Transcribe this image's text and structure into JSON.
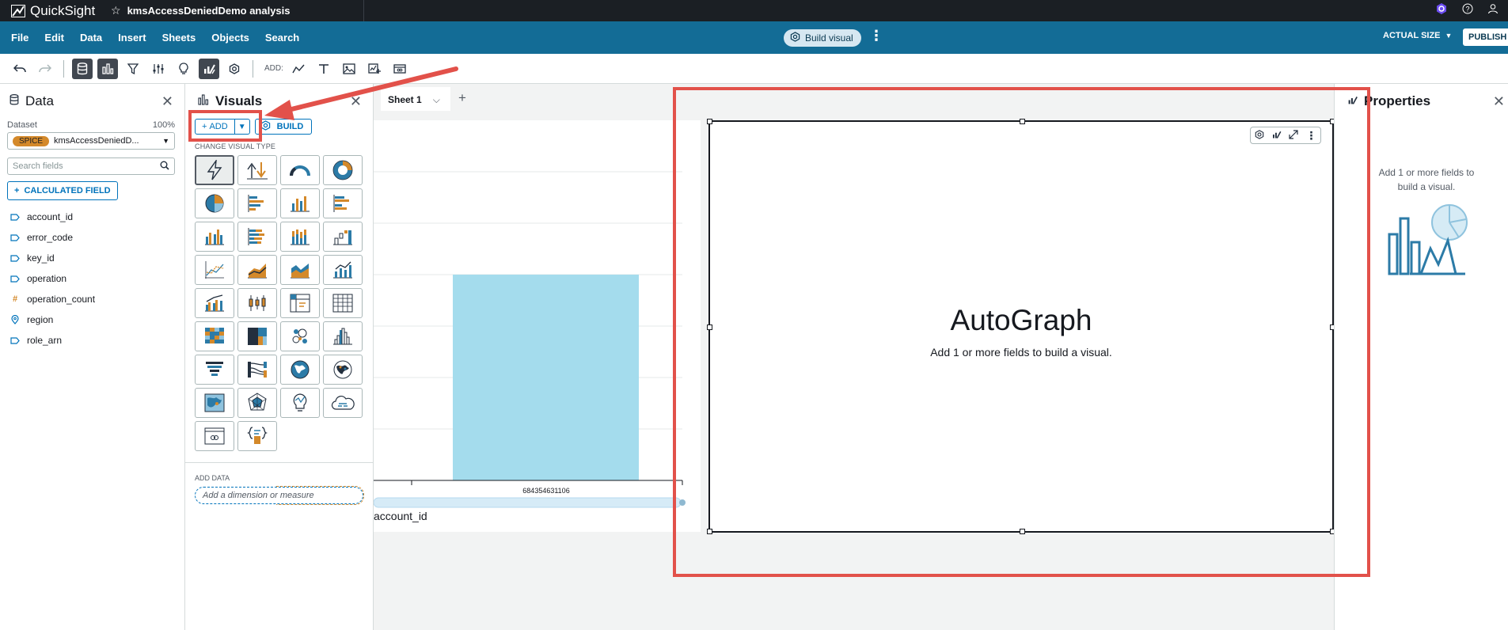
{
  "app": {
    "brand": "QuickSight",
    "analysis_title": "kmsAccessDeniedDemo analysis"
  },
  "menu": {
    "items": [
      "File",
      "Edit",
      "Data",
      "Insert",
      "Sheets",
      "Objects",
      "Search"
    ],
    "build_visual": "Build visual",
    "size_label": "ACTUAL SIZE",
    "publish": "PUBLISH"
  },
  "toolbar": {
    "add_label": "ADD:"
  },
  "data_panel": {
    "title": "Data",
    "dataset_label": "Dataset",
    "dataset_pct": "100%",
    "spice_badge": "SPICE",
    "dataset_name": "kmsAccessDeniedD...",
    "search_placeholder": "Search fields",
    "calc_field": "CALCULATED FIELD",
    "fields": [
      {
        "name": "account_id",
        "type": "dimension"
      },
      {
        "name": "error_code",
        "type": "dimension"
      },
      {
        "name": "key_id",
        "type": "dimension"
      },
      {
        "name": "operation",
        "type": "dimension"
      },
      {
        "name": "operation_count",
        "type": "measure"
      },
      {
        "name": "region",
        "type": "geo"
      },
      {
        "name": "role_arn",
        "type": "dimension"
      }
    ]
  },
  "visuals_panel": {
    "title": "Visuals",
    "add_button": "ADD",
    "build_button": "BUILD",
    "change_type_label": "CHANGE VISUAL TYPE",
    "add_data_label": "ADD DATA",
    "add_data_placeholder": "Add a dimension or measure"
  },
  "canvas": {
    "sheet_tab": "Sheet 1",
    "bar_chart": {
      "x_tick": "684354631106",
      "x_label": "account_id",
      "bar_color": "#a4dced"
    },
    "autograph": {
      "title": "AutoGraph",
      "subtitle": "Add 1 or more fields to build a visual."
    }
  },
  "properties_panel": {
    "title": "Properties",
    "message": "Add 1 or more fields to build a visual."
  },
  "colors": {
    "menubar": "#136c96",
    "accent": "#0073bb",
    "annotation": "#e2514a",
    "spice": "#d4892a"
  }
}
